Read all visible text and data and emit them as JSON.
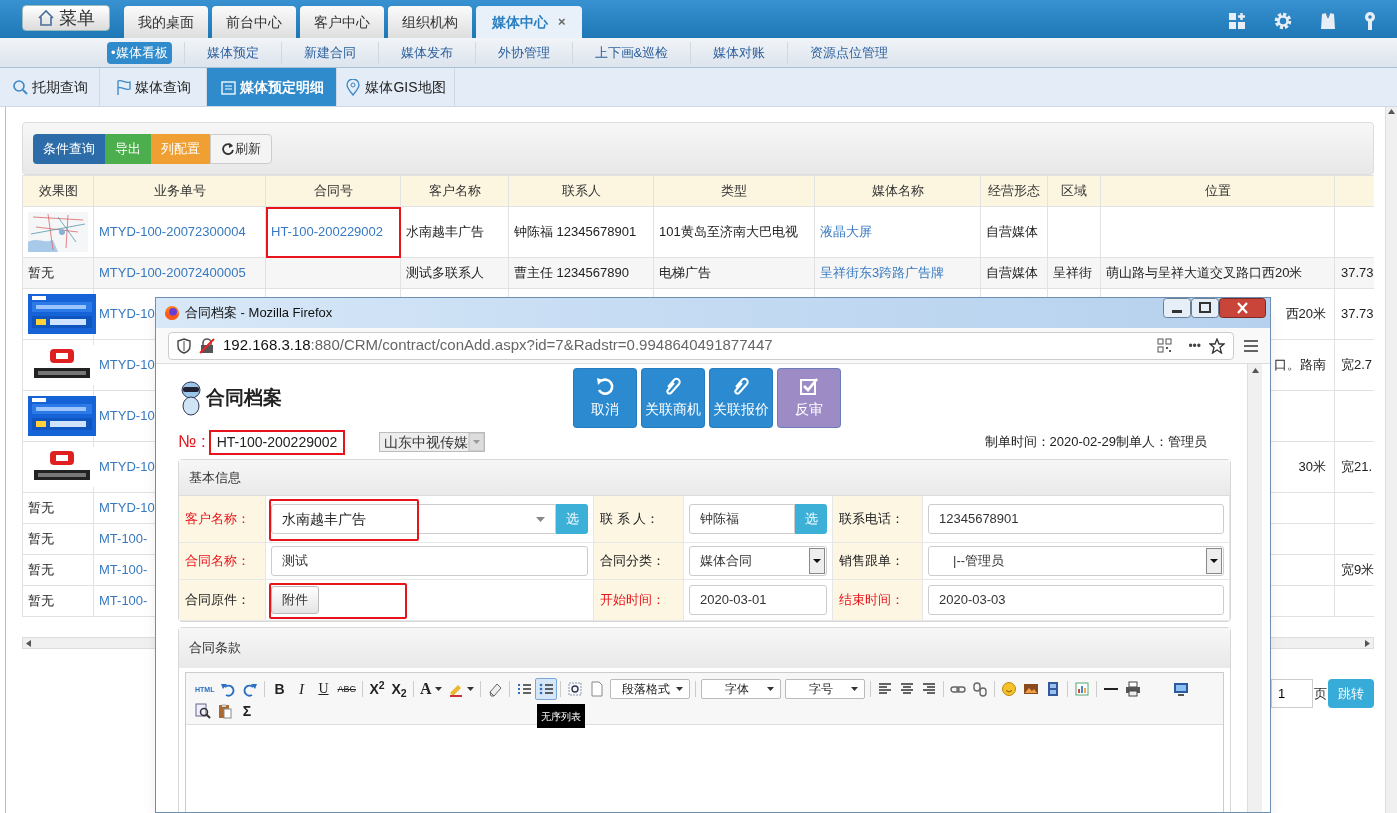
{
  "menu_button": {
    "label": "菜单"
  },
  "top_tabs": [
    {
      "label": "我的桌面",
      "selected": false
    },
    {
      "label": "前台中心",
      "selected": false
    },
    {
      "label": "客户中心",
      "selected": false
    },
    {
      "label": "组织机构",
      "selected": false
    },
    {
      "label": "媒体中心",
      "selected": true,
      "close_label": "×"
    }
  ],
  "sub_nav": [
    {
      "label": "•媒体看板",
      "selected": true
    },
    {
      "label": "媒体预定",
      "selected": false
    },
    {
      "label": "新建合同",
      "selected": false
    },
    {
      "label": "媒体发布",
      "selected": false
    },
    {
      "label": "外协管理",
      "selected": false
    },
    {
      "label": "上下画&巡检",
      "selected": false
    },
    {
      "label": "媒体对账",
      "selected": false
    },
    {
      "label": "资源点位管理",
      "selected": false
    }
  ],
  "page_tabs": [
    {
      "label": "托期查询",
      "selected": false
    },
    {
      "label": "媒体查询",
      "selected": false
    },
    {
      "label": "媒体预定明细",
      "selected": true
    },
    {
      "label": "媒体GIS地图",
      "selected": false
    }
  ],
  "toolbar_buttons": [
    {
      "label": "条件查询",
      "color": "#2c6ca8",
      "kind": "button"
    },
    {
      "label": "导出",
      "color": "#4cae4c",
      "kind": "button"
    },
    {
      "label": "列配置",
      "color": "#f0a032",
      "kind": "button"
    },
    {
      "label": "刷新",
      "color": "#f4f4f4",
      "kind": "icon_button"
    }
  ],
  "table": {
    "columns": [
      "效果图",
      "业务单号",
      "合同号",
      "客户名称",
      "联系人",
      "类型",
      "媒体名称",
      "经营形态",
      "区域",
      "位置"
    ],
    "rows": [
      {
        "kind": "picture",
        "order_no": "MTYD-100-20072300004",
        "contract_no": "HT-100-200229002",
        "contract_highlighted": true,
        "customer": "水南越丰广告",
        "contact": "钟陈福 12345678901",
        "type": "101黄岛至济南大巴电视",
        "media_name": "液晶大屏",
        "operation": "自营媒体",
        "area": "",
        "position": "",
        "column_11": ""
      },
      {
        "kind": "text",
        "thumbnail": "暂无",
        "order_no": "MTYD-100-20072400005",
        "contract_no": "",
        "customer": "测试多联系人",
        "contact": "曹主任 1234567890",
        "type": "电梯广告",
        "media_name": "呈祥街东3跨路广告牌",
        "operation": "自营媒体",
        "area": "呈祥街",
        "position": "萌山路与呈祥大道交叉路口西20米",
        "column_11": "37.73"
      },
      {
        "kind": "picture",
        "order_no": "MTYD-10",
        "position": "西20米",
        "column_11": "37.73"
      },
      {
        "kind": "picture",
        "order_no": "MTYD-10",
        "position": "口。路南",
        "column_11": "宽2.7"
      },
      {
        "kind": "picture",
        "order_no": "MTYD-10",
        "position": "",
        "column_11": ""
      },
      {
        "kind": "picture",
        "order_no": "MTYD-10",
        "position": "30米",
        "column_11": "宽21."
      },
      {
        "kind": "text",
        "thumbnail": "暂无",
        "order_no": "MTYD-10",
        "position": "",
        "column_11": ""
      },
      {
        "kind": "text",
        "thumbnail": "暂无",
        "order_no": "MT-100-",
        "position": "",
        "column_11": ""
      },
      {
        "kind": "text",
        "thumbnail": "暂无",
        "order_no": "MT-100-",
        "position": "",
        "column_11": "宽9米"
      },
      {
        "kind": "text",
        "thumbnail": "暂无",
        "order_no": "MT-100-",
        "position": "",
        "column_11": ""
      }
    ]
  },
  "pager": {
    "page": "1",
    "suffix": "页",
    "go": "跳转"
  },
  "popup": {
    "title": "合同档案 - Mozilla Firefox",
    "url_host": "192.168.3.18",
    "url_rest": ":880/CRM/contract/conAdd.aspx?id=7&Radstr=0.9948640491877447",
    "more": "•••",
    "page_title": "合同档案",
    "actions": [
      {
        "label": "取消",
        "color": "#2b8ad0"
      },
      {
        "label": "关联商机",
        "color": "#2b8ad0"
      },
      {
        "label": "关联报价",
        "color": "#2b8ad0"
      },
      {
        "label": "反审",
        "color": "#9d8bc6"
      }
    ],
    "number_label": "№ :",
    "number": "HT-100-200229002",
    "number_highlighted": true,
    "company": "山东中视传媒",
    "meta": "制单时间：2020-02-29制单人：管理员",
    "basic": {
      "title": "基本信息",
      "fields": [
        {
          "label": "客户名称：",
          "required": true,
          "kind": "combo_pick",
          "value": "水南越丰广告",
          "pick": "选",
          "highlighted": true
        },
        {
          "label": "联 系 人：",
          "required": false,
          "kind": "input_pick",
          "value": "钟陈福",
          "pick": "选"
        },
        {
          "label": "联系电话：",
          "required": false,
          "kind": "input",
          "value": "12345678901"
        },
        {
          "label": "合同名称：",
          "required": true,
          "kind": "input",
          "value": "测试"
        },
        {
          "label": "合同分类：",
          "required": false,
          "kind": "select",
          "value": "媒体合同"
        },
        {
          "label": "销售跟单：",
          "required": false,
          "kind": "select",
          "value": "|--管理员"
        },
        {
          "label": "合同原件：",
          "required": false,
          "kind": "button",
          "value": "附件",
          "highlighted": true
        },
        {
          "label": "开始时间：",
          "required": true,
          "kind": "input",
          "value": "2020-03-01"
        },
        {
          "label": "结束时间：",
          "required": true,
          "kind": "input",
          "value": "2020-03-03"
        }
      ]
    },
    "terms": {
      "title": "合同条款",
      "tooltip": "无序列表",
      "toolbar": [
        {
          "kind": "tiny",
          "text": "HTML",
          "selected": false
        },
        {
          "kind": "icon",
          "selected": false
        },
        {
          "kind": "icon",
          "selected": false
        },
        {
          "kind": "sep"
        },
        {
          "kind": "bold",
          "text": "B",
          "selected": false
        },
        {
          "kind": "italic",
          "text": "I",
          "selected": false
        },
        {
          "kind": "underline",
          "text": "U",
          "selected": false
        },
        {
          "kind": "strike",
          "text": "ABC",
          "selected": false
        },
        {
          "kind": "sep"
        },
        {
          "kind": "bold",
          "text": "X$^{2}$",
          "selected": false
        },
        {
          "kind": "bold",
          "text": "X$_{2}$",
          "selected": false
        },
        {
          "kind": "sep"
        },
        {
          "kind": "letter_menu",
          "text": "A",
          "selected": false
        },
        {
          "kind": "icon_menu",
          "selected": false
        },
        {
          "kind": "sep"
        },
        {
          "kind": "icon",
          "selected": false
        },
        {
          "kind": "sep"
        },
        {
          "kind": "icon",
          "selected": false
        },
        {
          "kind": "icon",
          "selected": true
        },
        {
          "kind": "sep"
        },
        {
          "kind": "icon",
          "selected": false
        },
        {
          "kind": "icon",
          "selected": false
        },
        {
          "kind": "dropdown",
          "label": "段落格式"
        },
        {
          "kind": "sep"
        },
        {
          "kind": "dropdown",
          "label": "字体"
        },
        {
          "kind": "dropdown",
          "label": "字号"
        },
        {
          "kind": "sep"
        },
        {
          "kind": "icon",
          "selected": false
        },
        {
          "kind": "icon",
          "selected": false
        },
        {
          "kind": "icon",
          "selected": false
        },
        {
          "kind": "sep"
        },
        {
          "kind": "icon",
          "selected": false
        },
        {
          "kind": "icon",
          "selected": false
        },
        {
          "kind": "sep"
        },
        {
          "kind": "icon",
          "selected": false
        },
        {
          "kind": "icon",
          "selected": false
        },
        {
          "kind": "icon",
          "selected": false
        },
        {
          "kind": "sep"
        },
        {
          "kind": "icon",
          "selected": false
        },
        {
          "kind": "sep"
        },
        {
          "kind": "icon",
          "selected": false
        },
        {
          "kind": "icon",
          "selected": false
        },
        {
          "kind": "gap"
        },
        {
          "kind": "icon",
          "selected": false
        },
        {
          "kind": "break"
        },
        {
          "kind": "icon",
          "selected": false
        },
        {
          "kind": "icon",
          "selected": false
        },
        {
          "kind": "bold",
          "text": "Σ",
          "selected": false
        }
      ]
    }
  }
}
